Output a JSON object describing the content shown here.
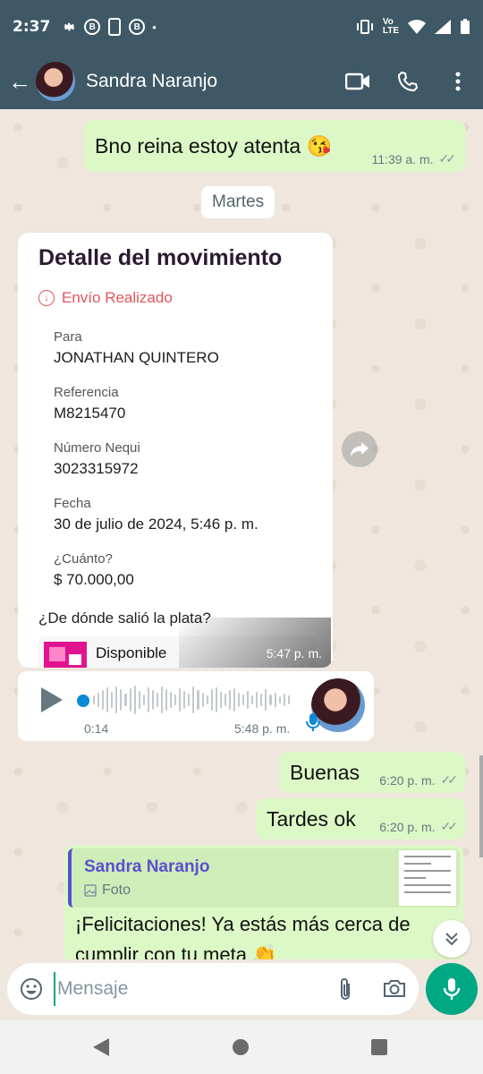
{
  "status_bar": {
    "time": "2:37",
    "net_label": "Vo\nLTE"
  },
  "header": {
    "contact_name": "Sandra Naranjo"
  },
  "messages": {
    "m1": {
      "text": "Bno reina estoy atenta 😘",
      "time": "11:39 a. m."
    },
    "date_chip": "Martes",
    "receipt": {
      "title": "Detalle del movimiento",
      "status": "Envío Realizado",
      "fields": [
        {
          "label": "Para",
          "value": "JONATHAN QUINTERO"
        },
        {
          "label": "Referencia",
          "value": "M8215470"
        },
        {
          "label": "Número Nequi",
          "value": "3023315972"
        },
        {
          "label": "Fecha",
          "value": "30 de julio de 2024, 5:46 p. m."
        },
        {
          "label": "¿Cuánto?",
          "value": "$ 70.000,00"
        }
      ],
      "question": "¿De dónde salió la plata?",
      "source": "Disponible",
      "time": "5:47 p. m."
    },
    "voice": {
      "duration": "0:14",
      "time": "5:48 p. m."
    },
    "m2": {
      "text": "Buenas",
      "time": "6:20 p. m."
    },
    "m3": {
      "text": "Tardes ok",
      "time": "6:20 p. m."
    },
    "reply": {
      "quoted_name": "Sandra Naranjo",
      "quoted_type": "Foto",
      "text": "¡Felicitaciones! Ya estás más cerca de cumplir con tu meta 👏"
    }
  },
  "composer": {
    "placeholder": "Mensaje"
  },
  "colors": {
    "header": "#3e5965",
    "outgoing": "#dcf8c6",
    "accent": "#00a884",
    "purple": "#5b4fd0"
  }
}
